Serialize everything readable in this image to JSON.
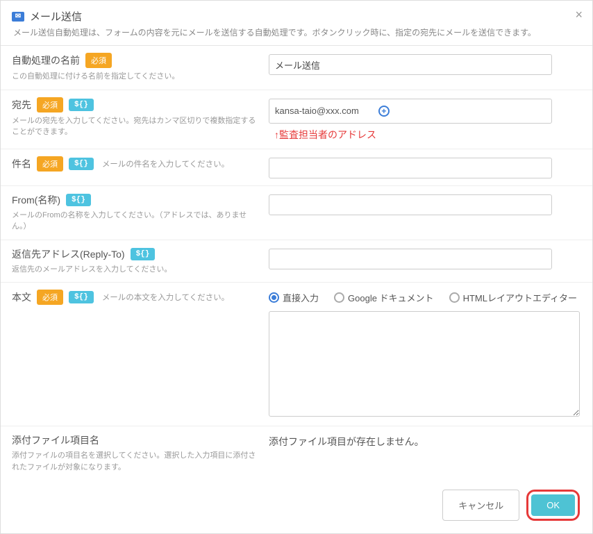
{
  "header": {
    "title": "メール送信",
    "subtitle": "メール送信自動処理は、フォームの内容を元にメールを送信する自動処理です。ボタンクリック時に、指定の宛先にメールを送信できます。",
    "close": "×"
  },
  "badges": {
    "required": "必須",
    "variable": "${}"
  },
  "fields": {
    "name": {
      "label": "自動処理の名前",
      "help": "この自動処理に付ける名前を指定してください。",
      "value": "メール送信"
    },
    "to": {
      "label": "宛先",
      "help": "メールの宛先を入力してください。宛先はカンマ区切りで複数指定することができます。",
      "value": "kansa-taio@xxx.com",
      "annotation": "↑監査担当者のアドレス"
    },
    "subject": {
      "label": "件名",
      "help_inline": "メールの件名を入力してください。",
      "value": ""
    },
    "from_name": {
      "label": "From(名称)",
      "help": "メールのFromの名称を入力してください。（アドレスでは、ありません。）",
      "value": ""
    },
    "reply_to": {
      "label": "返信先アドレス(Reply-To)",
      "help": "返信先のメールアドレスを入力してください。",
      "value": ""
    },
    "body": {
      "label": "本文",
      "help_inline": "メールの本文を入力してください。",
      "radio_options": {
        "direct": "直接入力",
        "google_doc": "Google ドキュメント",
        "html_editor": "HTMLレイアウトエディター"
      },
      "value": ""
    },
    "attachment": {
      "label": "添付ファイル項目名",
      "help": "添付ファイルの項目名を選択してください。選択した入力項目に添付されたファイルが対象になります。",
      "empty_text": "添付ファイル項目が存在しません。"
    }
  },
  "footer": {
    "cancel": "キャンセル",
    "ok": "OK"
  }
}
